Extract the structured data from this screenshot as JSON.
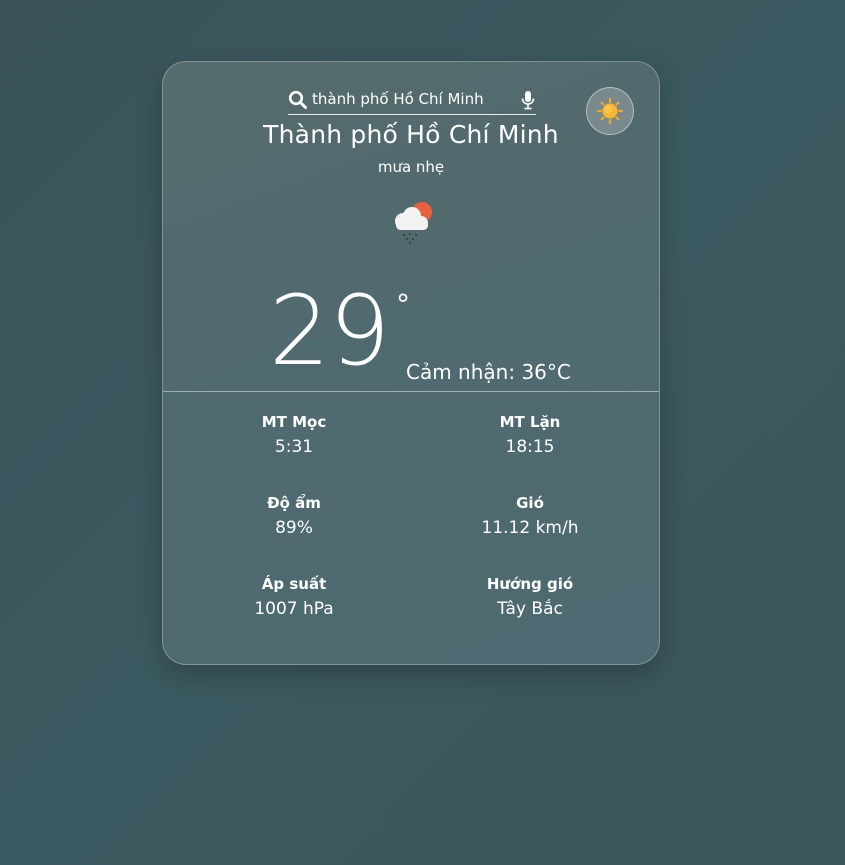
{
  "search": {
    "value": "thành phố Hồ Chí Minh",
    "placeholder": ""
  },
  "location": {
    "city": "Thành phố Hồ Chí Minh",
    "description": "mưa nhẹ"
  },
  "weather": {
    "icon": "rain-cloud-sun-icon",
    "temperature": "29",
    "degree_symbol": "°",
    "feels_like": "Cảm nhận: 36°C"
  },
  "stats": {
    "sunrise": {
      "label": "MT Mọc",
      "value": "5:31"
    },
    "sunset": {
      "label": "MT Lặn",
      "value": "18:15"
    },
    "humidity": {
      "label": "Độ ẩm",
      "value": "89%"
    },
    "wind": {
      "label": "Gió",
      "value": "11.12 km/h"
    },
    "pressure": {
      "label": "Áp suất",
      "value": "1007 hPa"
    },
    "wind_direction": {
      "label": "Hướng gió",
      "value": "Tây Bắc"
    }
  },
  "icons": {
    "search": "search-icon",
    "mic": "microphone-icon",
    "theme": "sun-icon"
  },
  "colors": {
    "background": "#3b5960",
    "card": "#536b6f",
    "sun": "#f0a020",
    "sun_weather": "#e8613f"
  }
}
